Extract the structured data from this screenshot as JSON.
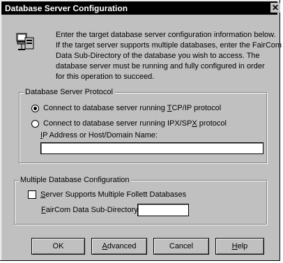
{
  "window": {
    "title": "Database Server Configuration",
    "close_glyph": "✕"
  },
  "intro": {
    "icon": "network-computer-icon",
    "lines": [
      "Enter the target database server configuration information below.",
      "If the target server supports multiple databases, enter the FairCom",
      "Data Sub-Directory of the database you wish to access.  The",
      "database server must be running and fully configured in order",
      "for this operation to succeed."
    ]
  },
  "protocol_group": {
    "legend": "Database Server Protocol",
    "tcp": {
      "prefix": "Connect to database server running ",
      "mnemonic": "T",
      "suffix": "CP/IP protocol",
      "checked": true
    },
    "ipx": {
      "prefix": "Connect to database server running IPX/SP",
      "mnemonic": "X",
      "suffix": " protocol",
      "checked": false
    },
    "address_label": {
      "mnemonic": "I",
      "rest": "P Address or Host/Domain Name:"
    },
    "address_value": ""
  },
  "multi_group": {
    "legend": "Multiple Database Configuration",
    "checkbox": {
      "mnemonic": "S",
      "rest": "erver Supports Multiple Follett Databases",
      "checked": false
    },
    "subdir_label": {
      "mnemonic": "F",
      "rest": "airCom Data Sub-Directory:"
    },
    "subdir_value": ""
  },
  "buttons": {
    "ok": "OK",
    "advanced": {
      "mnemonic": "A",
      "rest": "dvanced"
    },
    "cancel": "Cancel",
    "help": {
      "mnemonic": "H",
      "rest": "elp"
    }
  }
}
